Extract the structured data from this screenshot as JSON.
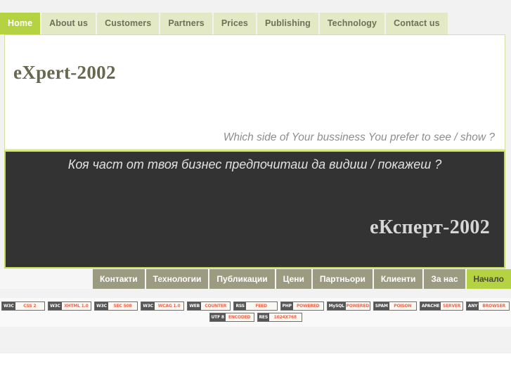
{
  "top_nav": {
    "items": [
      {
        "label": "Home",
        "active": true
      },
      {
        "label": "About us",
        "active": false
      },
      {
        "label": "Customers",
        "active": false
      },
      {
        "label": "Partners",
        "active": false
      },
      {
        "label": "Prices",
        "active": false
      },
      {
        "label": "Publishing",
        "active": false
      },
      {
        "label": "Technology",
        "active": false
      },
      {
        "label": "Contact us",
        "active": false
      }
    ]
  },
  "light_panel": {
    "brand": "eXpert-2002",
    "tagline": "Which side of Your bussiness You prefer to see / show ?"
  },
  "dark_panel": {
    "tagline": "Коя част от твоя бизнес предпочиташ да видиш / покажеш ?",
    "brand": "еКсперт-2002"
  },
  "bottom_nav": {
    "items": [
      {
        "label": "Контакти",
        "active": false
      },
      {
        "label": "Технологии",
        "active": false
      },
      {
        "label": "Публикации",
        "active": false
      },
      {
        "label": "Цени",
        "active": false
      },
      {
        "label": "Партньори",
        "active": false
      },
      {
        "label": "Клиенти",
        "active": false
      },
      {
        "label": "За нас",
        "active": false
      },
      {
        "label": "Начало",
        "active": true
      }
    ]
  },
  "badges": {
    "row1": [
      {
        "left": "W3C",
        "right": "CSS 2"
      },
      {
        "left": "W3C",
        "right": "XHTML 1.0"
      },
      {
        "left": "W3C",
        "right": "SEC 508"
      },
      {
        "left": "W3C",
        "right": "WCAG 1.0"
      },
      {
        "left": "WEB",
        "right": "COUNTER"
      },
      {
        "left": "RSS",
        "right": "FEED"
      },
      {
        "left": "PHP",
        "right": "POWERED"
      },
      {
        "left": "MySQL",
        "right": "POWERED"
      },
      {
        "left": "SPAM",
        "right": "POISON"
      },
      {
        "left": "APACHE",
        "right": "SERVER"
      },
      {
        "left": "ANY",
        "right": "BROWSER"
      }
    ],
    "row2": [
      {
        "left": "UTF 8",
        "right": "ENCODED"
      },
      {
        "left": "RES",
        "right": "1024X768"
      }
    ]
  },
  "colors": {
    "accent_green": "#b4d242",
    "nav_light_green": "#e2e9c4",
    "dark_panel": "#333333",
    "dark_border": "#c0da56",
    "olive_nav": "#9b9b82",
    "badge_orange": "#f0674a"
  }
}
